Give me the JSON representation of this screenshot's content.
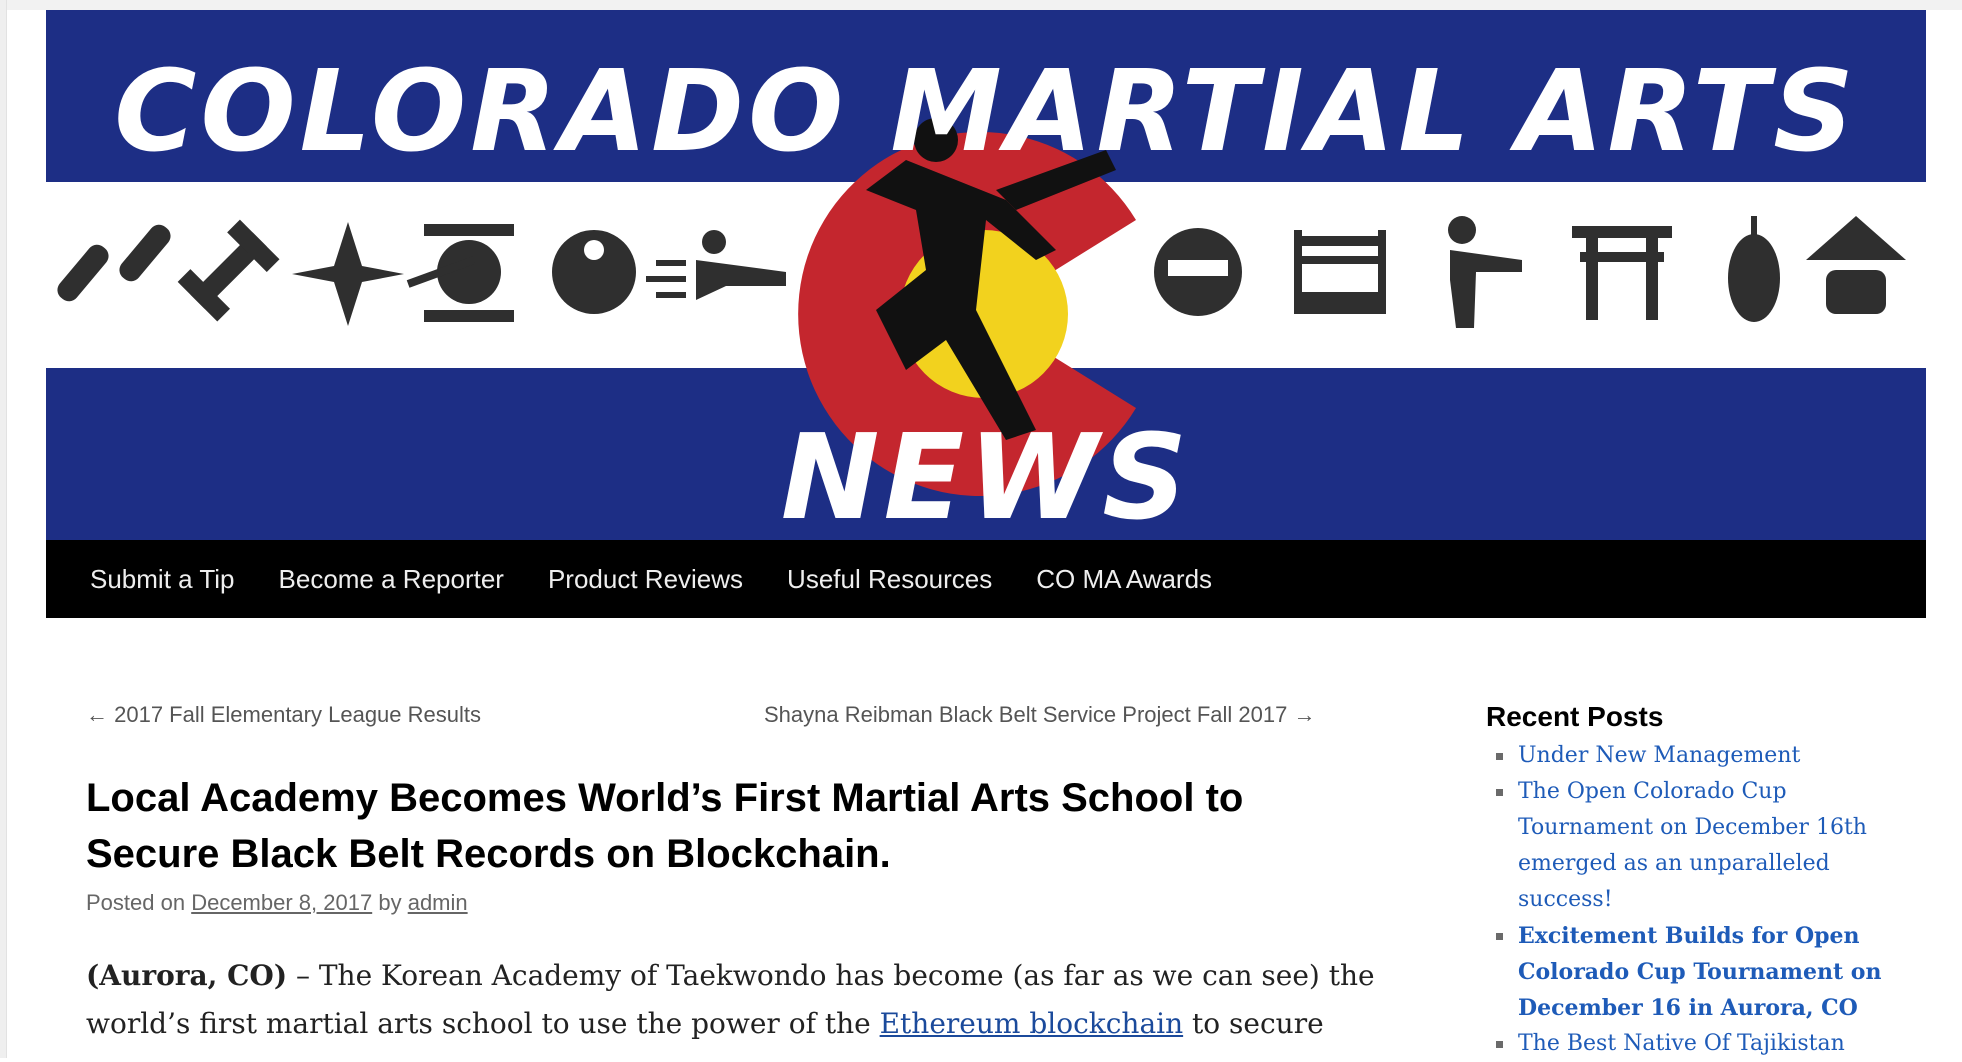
{
  "banner": {
    "title_top": "COLORADO MARTIAL ARTS",
    "title_bottom": "NEWS",
    "colors": {
      "blue": "#1d2e85",
      "red": "#c4262e",
      "yellow": "#f2d21e",
      "white": "#ffffff"
    },
    "icons_left": [
      "nunchaku-icon",
      "dumbbell-icon",
      "shuriken-icon",
      "gong-icon",
      "yin-yang-icon",
      "flying-kick-icon"
    ],
    "icons_right": [
      "ninja-icon",
      "boxing-ring-icon",
      "high-kick-icon",
      "torii-gate-icon",
      "punching-bag-icon",
      "sensei-hat-icon"
    ]
  },
  "nav": {
    "items": [
      "Submit a Tip",
      "Become a Reporter",
      "Product Reviews",
      "Useful Resources",
      "CO MA Awards"
    ]
  },
  "post_nav": {
    "prev": "← 2017 Fall Elementary League Results",
    "next": "Shayna Reibman Black Belt Service Project Fall 2017 →"
  },
  "article": {
    "title": "Local Academy Becomes World’s First Martial Arts School to Secure Black Belt Records on Blockchain.",
    "meta": {
      "posted_on": "Posted on",
      "date": "December 8, 2017",
      "by": "by",
      "author": "admin"
    },
    "body": {
      "place": "(Aurora, CO)",
      "text_1": " – The Korean Academy of Taekwondo has become (as far as we can see) the world’s first martial arts school to use the power of the ",
      "link": "Ethereum blockchain",
      "text_2": " to secure"
    }
  },
  "sidebar": {
    "heading": "Recent Posts",
    "posts": [
      {
        "label": "Under New Management",
        "bold": false
      },
      {
        "label": "The Open Colorado Cup Tournament on December 16th emerged as an unparalleled success!",
        "bold": false
      },
      {
        "label": "Excitement Builds for Open Colorado Cup Tournament on December 16 in Aurora, CO",
        "bold": true
      },
      {
        "label": "The Best Native Of Tajikistan",
        "bold": false
      }
    ]
  }
}
